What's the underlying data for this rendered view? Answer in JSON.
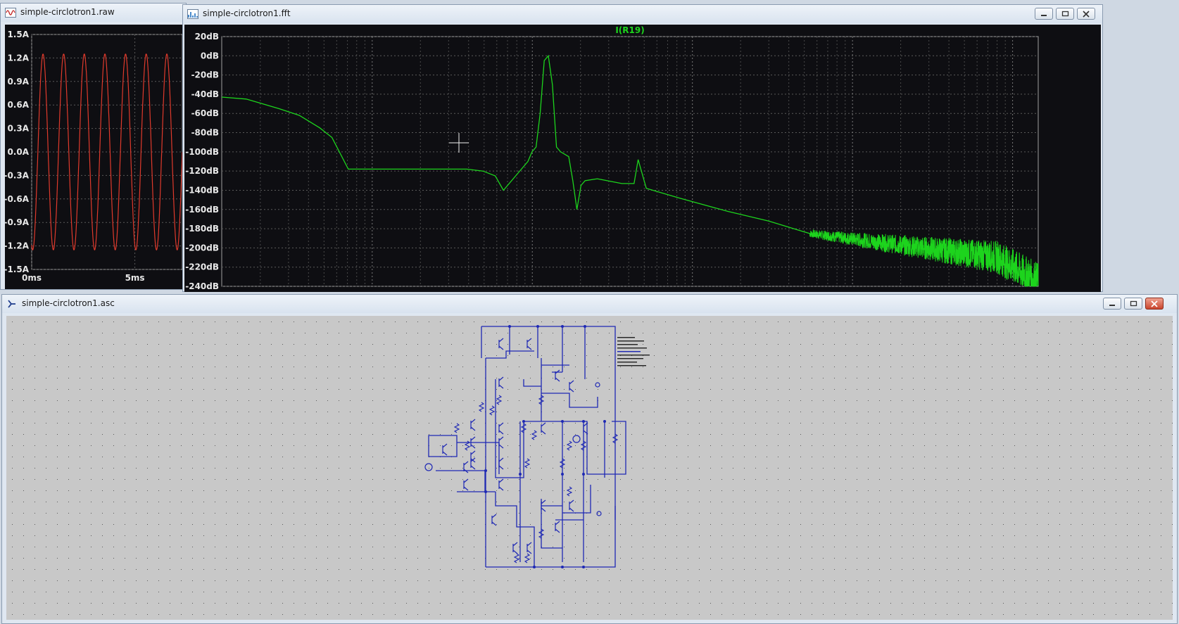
{
  "raw_window": {
    "title": "simple-circlotron1.raw",
    "icon": "waveform-icon",
    "trace_color": "#e03a2c",
    "y_ticks": [
      "1.5A",
      "1.2A",
      "0.9A",
      "0.6A",
      "0.3A",
      "0.0A",
      "-0.3A",
      "-0.6A",
      "-0.9A",
      "-1.2A",
      "-1.5A"
    ],
    "x_ticks": [
      "0ms",
      "5ms"
    ]
  },
  "fft_window": {
    "title": "simple-circlotron1.fft",
    "icon": "spectrum-icon",
    "trace_label": "I(R19)",
    "trace_color": "#1dd41d",
    "y_ticks": [
      "20dB",
      "0dB",
      "-20dB",
      "-40dB",
      "-60dB",
      "-80dB",
      "-100dB",
      "-120dB",
      "-140dB",
      "-160dB",
      "-180dB",
      "-200dB",
      "-220dB",
      "-240dB"
    ],
    "controls": {
      "minimize": "minimize-icon",
      "restore": "restore-icon",
      "close": "close-icon"
    }
  },
  "schematic_window": {
    "title": "simple-circlotron1.asc",
    "icon": "schematic-icon",
    "wire_color": "#1e28b4",
    "controls": {
      "minimize": "minimize-icon",
      "restore": "restore-icon",
      "close": "close-icon"
    }
  },
  "chart_data": [
    {
      "type": "line",
      "title": "",
      "xlabel": "",
      "ylabel": "",
      "x_tick_labels": [
        "0ms",
        "5ms"
      ],
      "xlim": [
        0,
        7.3
      ],
      "ylim": [
        -1.5,
        1.5
      ],
      "grid": true,
      "series": [
        {
          "amplitude": 1.25,
          "period_ms": 1.0,
          "values_note": "sine"
        }
      ]
    },
    {
      "type": "line",
      "title": "I(R19)",
      "ylabel": "",
      "xlabel": "",
      "ylim": [
        -240,
        20
      ],
      "x_scale": "log",
      "grid": true,
      "series": [
        {
          "name": "I(R19)",
          "x": [
            0.0,
            0.03,
            0.07,
            0.095,
            0.12,
            0.135,
            0.155,
            0.19,
            0.25,
            0.3,
            0.32,
            0.335,
            0.345,
            0.36,
            0.375,
            0.38,
            0.385,
            0.39,
            0.395,
            0.4,
            0.405,
            0.41,
            0.415,
            0.425,
            0.43,
            0.435,
            0.44,
            0.445,
            0.46,
            0.49,
            0.505,
            0.51,
            0.52,
            0.56,
            0.62,
            0.67,
            0.72
          ],
          "y": [
            -43,
            -45,
            -55,
            -62,
            -75,
            -85,
            -118,
            -118,
            -118,
            -118,
            -120,
            -125,
            -140,
            -125,
            -110,
            -100,
            -95,
            -60,
            -5,
            0,
            -30,
            -95,
            -100,
            -105,
            -130,
            -160,
            -135,
            -130,
            -128,
            -133,
            -133,
            -108,
            -138,
            -148,
            -162,
            -172,
            -185
          ]
        }
      ]
    }
  ]
}
